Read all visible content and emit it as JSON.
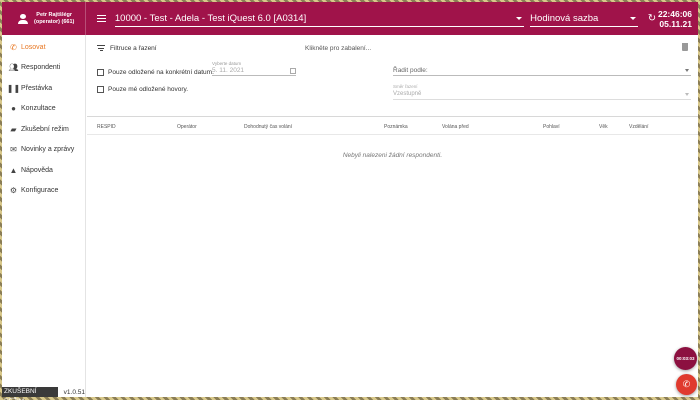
{
  "header": {
    "user_name": "Petr Rajtšlégr",
    "user_role": "(operator) (661)",
    "project": "10000 - Test - Adela - Test iQuest 6.0 [A0314]",
    "rate": "Hodinová sazba",
    "time": "22:46:06",
    "date": "05.11.21"
  },
  "sidebar": {
    "items": [
      {
        "label": "Losovat",
        "icon": "phone-icon"
      },
      {
        "label": "Respondenti",
        "icon": "people-icon"
      },
      {
        "label": "Přestávka",
        "icon": "pause-icon"
      },
      {
        "label": "Konzultace",
        "icon": "group-icon"
      },
      {
        "label": "Zkušební režim",
        "icon": "car-icon"
      },
      {
        "label": "Novinky a zprávy",
        "icon": "mail-icon"
      },
      {
        "label": "Nápověda",
        "icon": "school-icon"
      },
      {
        "label": "Konfigurace",
        "icon": "gear-icon"
      }
    ],
    "test_mode": "ZKUŠEBNÍ REŽIM",
    "version": "v1.0.51"
  },
  "filters": {
    "title": "Filtruce a řazení",
    "collapse_hint": "Klikněte pro zabalení...",
    "only_postponed_date": "Pouze odložené na konkrétní datum.",
    "only_my_postponed": "Pouze mé odložené hovory.",
    "date_label": "Vyberte datum",
    "date_value": "5. 11. 2021",
    "sort_label": "Řadit podle:",
    "order_label": "Směr řazení",
    "order_value": "Vzestupně"
  },
  "table": {
    "columns": [
      "RESPID",
      "Operátor",
      "Dohodnutý čas volání",
      "Poznámka",
      "Volána před",
      "Pohlaví",
      "Věk",
      "Vzdělání"
    ],
    "empty_message": "Nebyli nalezeni žádní respondenti."
  },
  "fab": {
    "timer": "00:03:03"
  },
  "colors": {
    "brand": "#a0134a",
    "active": "#e87722",
    "call": "#e03a2e"
  }
}
